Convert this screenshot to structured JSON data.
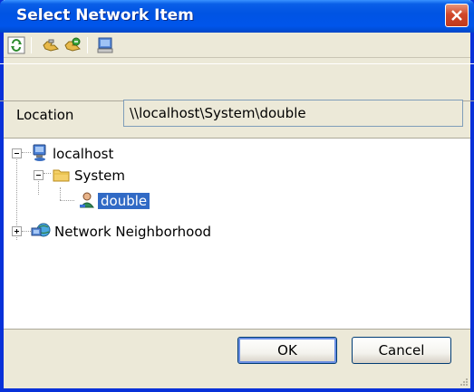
{
  "window": {
    "title": "Select Network Item"
  },
  "toolbar": {
    "buttons": [
      {
        "name": "refresh-icon"
      },
      {
        "name": "connect-icon"
      },
      {
        "name": "disconnect-icon"
      },
      {
        "name": "computer-icon"
      }
    ]
  },
  "location": {
    "label": "Location",
    "value": "\\\\localhost\\System\\double"
  },
  "tree": {
    "nodes": [
      {
        "label": "localhost",
        "icon": "computer-icon",
        "expanded": true
      },
      {
        "label": "System",
        "icon": "folder-icon",
        "expanded": true
      },
      {
        "label": "double",
        "icon": "user-icon",
        "selected": true
      },
      {
        "label": "Network Neighborhood",
        "icon": "network-icon",
        "expanded": false
      }
    ]
  },
  "buttons": {
    "ok": "OK",
    "cancel": "Cancel"
  },
  "colors": {
    "titlebar": "#0054E3",
    "selection": "#316AC5",
    "dialog_bg": "#ECE9D8"
  }
}
